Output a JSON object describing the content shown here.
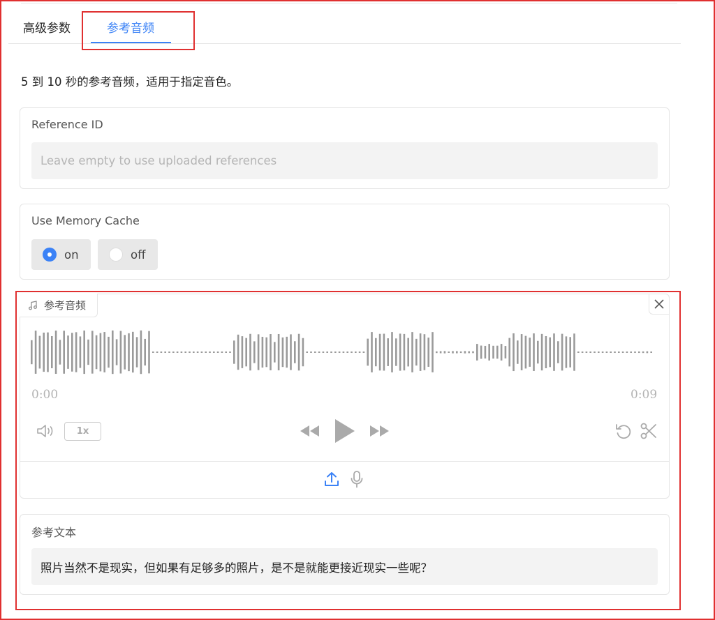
{
  "tabs": [
    {
      "label": "高级参数",
      "active": false
    },
    {
      "label": "参考音频",
      "active": true
    }
  ],
  "description": "5 到 10 秒的参考音频，适用于指定音色。",
  "reference_id": {
    "label": "Reference ID",
    "value": "",
    "placeholder": "Leave empty to use uploaded references"
  },
  "memory_cache": {
    "label": "Use Memory Cache",
    "options": [
      {
        "label": "on",
        "selected": true
      },
      {
        "label": "off",
        "selected": false
      }
    ]
  },
  "audio": {
    "tag_label": "参考音频",
    "time_start": "0:00",
    "time_end": "0:09",
    "speed_label": "1x",
    "icons": {
      "tag": "music-note-icon",
      "close": "close-icon",
      "volume": "volume-icon",
      "rewind": "rewind-icon",
      "play": "play-icon",
      "forward": "fast-forward-icon",
      "undo": "undo-icon",
      "trim": "scissors-icon",
      "upload": "upload-icon",
      "record": "microphone-icon"
    }
  },
  "reference_text": {
    "label": "参考文本",
    "value": "照片当然不是现实，但如果有足够多的照片，是不是就能更接近现实一些呢？"
  },
  "colors": {
    "accent": "#3b82f6",
    "highlight": "#e03030",
    "waveform": "#9a9a9a",
    "control": "#b0b0b0"
  }
}
